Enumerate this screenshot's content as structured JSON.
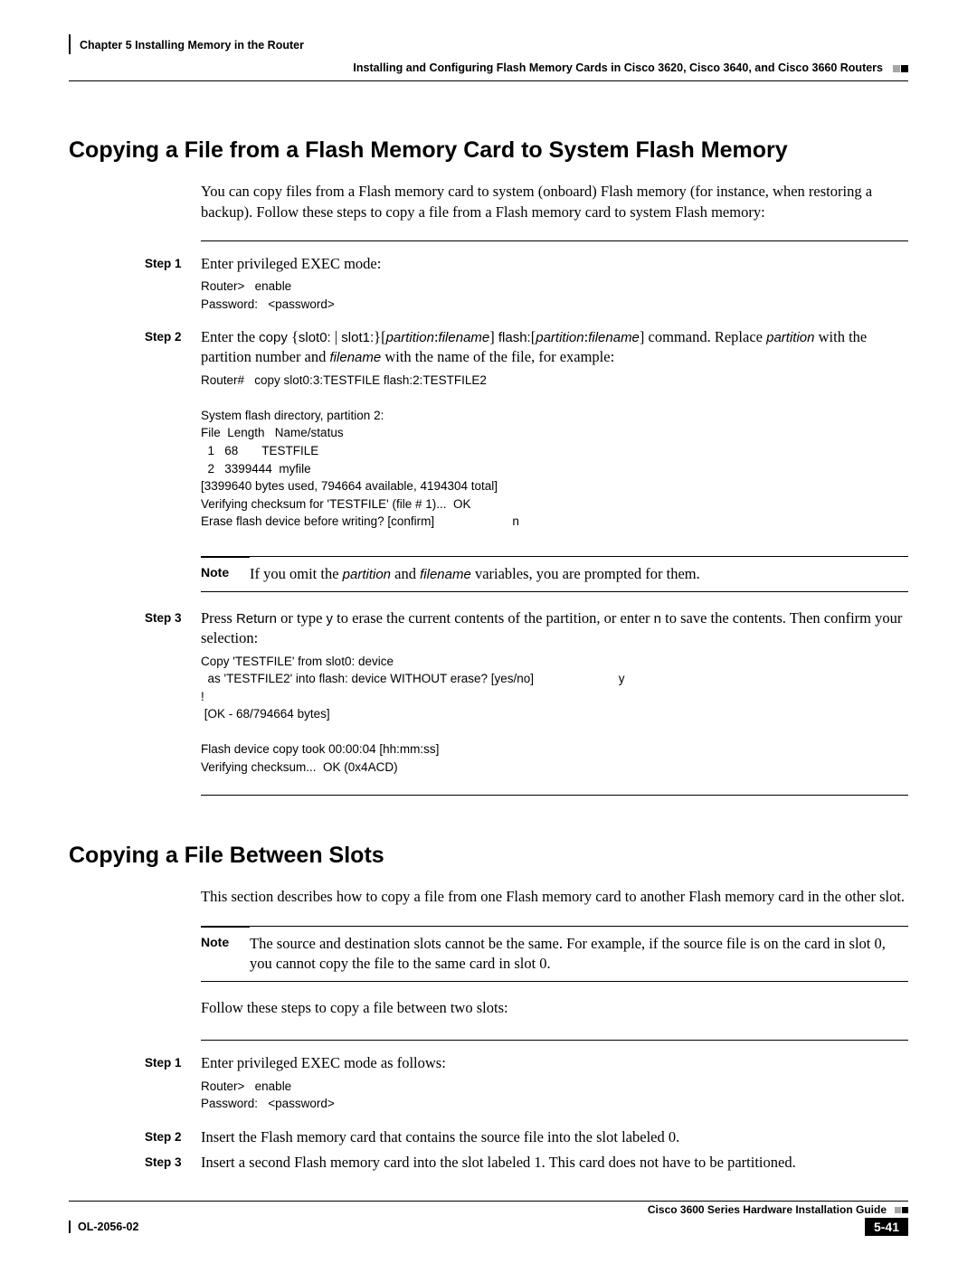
{
  "header": {
    "chapter": "Chapter 5      Installing Memory in the Router",
    "section": "Installing and Configuring Flash Memory Cards in Cisco 3620, Cisco 3640, and Cisco 3660 Routers"
  },
  "section1": {
    "title": "Copying a File from a Flash Memory Card to System Flash Memory",
    "intro": "You can copy files from a Flash memory card to system (onboard) Flash memory (for instance, when restoring a backup). Follow these steps to copy a file from a Flash memory card to system Flash memory:",
    "step1": {
      "label": "Step 1",
      "text": "Enter privileged EXEC mode:",
      "code": "Router>   enable\nPassword:   <password>"
    },
    "step2": {
      "label": "Step 2",
      "text_prefix": "Enter the ",
      "cmd1": "copy",
      "text_a": " {",
      "cmd2": "slot0:",
      "text_b": " | ",
      "cmd3": "slot1:",
      "text_c": "}[",
      "var1": "partition",
      "text_d": ":",
      "var2": "filename",
      "text_e": "] ",
      "cmd4": "flash:",
      "text_f": "[",
      "var3": "partition",
      "text_g": ":",
      "var4": "filename",
      "text_h": "] command. Replace ",
      "var5": "partition",
      "text_i": " with the partition number and ",
      "var6": "filename",
      "text_j": " with the name of the file, for example:",
      "code": "Router#   copy slot0:3:TESTFILE flash:2:TESTFILE2\n\nSystem flash directory, partition 2:\nFile  Length   Name/status\n  1   68       TESTFILE\n  2   3399444  myfile\n[3399640 bytes used, 794664 available, 4194304 total]\nVerifying checksum for 'TESTFILE' (file # 1)...  OK\nErase flash device before writing? [confirm]                       n"
    },
    "note1": {
      "label": "Note",
      "text_a": "If you omit the ",
      "v1": "partition",
      "text_b": " and ",
      "v2": "filename",
      "text_c": " variables, you are prompted for them."
    },
    "step3": {
      "label": "Step 3",
      "text_a": "Press ",
      "k1": "Return",
      "text_b": " or type ",
      "k2": "y",
      "text_c": " to erase the current contents of the partition, or enter ",
      "k3": "n",
      "text_d": " to save the contents. Then confirm your selection:",
      "code": "Copy 'TESTFILE' from slot0: device\n  as 'TESTFILE2' into flash: device WITHOUT erase? [yes/no]                         y\n!\n [OK - 68/794664 bytes]\n\nFlash device copy took 00:00:04 [hh:mm:ss]\nVerifying checksum...  OK (0x4ACD)"
    }
  },
  "section2": {
    "title": "Copying a File Between Slots",
    "intro": "This section describes how to copy a file from one Flash memory card to another Flash memory card in the other slot.",
    "note": {
      "label": "Note",
      "text": "The source and destination slots cannot be the same. For example, if the source file is on the card in slot 0, you cannot copy the file to the same card in slot 0."
    },
    "follow": "Follow these steps to copy a file between two slots:",
    "step1": {
      "label": "Step 1",
      "text": "Enter privileged EXEC mode as follows:",
      "code": "Router>   enable\nPassword:   <password>"
    },
    "step2": {
      "label": "Step 2",
      "text": "Insert the Flash memory card that contains the source file into the slot labeled 0."
    },
    "step3": {
      "label": "Step 3",
      "text": "Insert a second Flash memory card into the slot labeled 1. This card does not have to be partitioned."
    }
  },
  "footer": {
    "guide": "Cisco 3600 Series Hardware Installation Guide",
    "docid": "OL-2056-02",
    "pagenum": "5-41"
  }
}
